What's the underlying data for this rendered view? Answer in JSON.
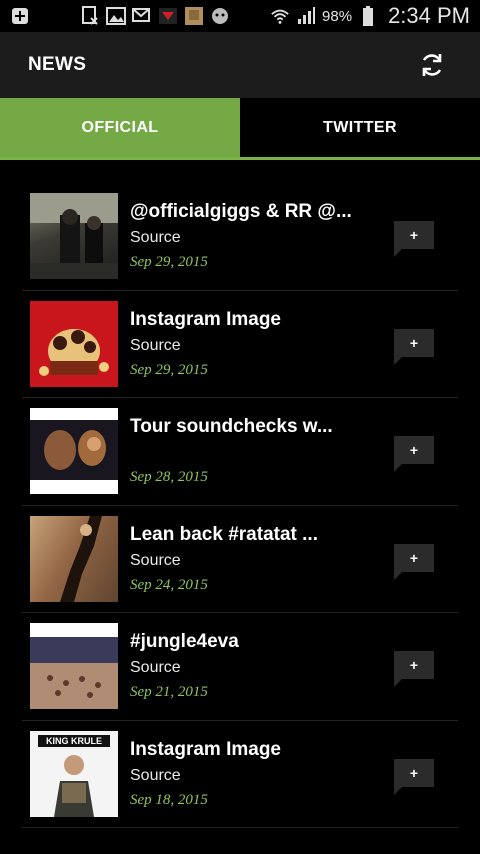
{
  "status_bar": {
    "battery": "98%",
    "time": "2:34 PM"
  },
  "app_bar": {
    "title": "NEWS",
    "refresh_icon": "refresh-icon"
  },
  "tabs": [
    {
      "label": "OFFICIAL",
      "active": true
    },
    {
      "label": "TWITTER",
      "active": false
    }
  ],
  "colors": {
    "accent": "#74a945",
    "date": "#8fc45e",
    "background": "#000000",
    "app_bar": "#1c1c1c"
  },
  "news": [
    {
      "title": "@officialgiggs & RR @...",
      "source": "Source",
      "date": "Sep 29, 2015",
      "add_label": "+",
      "thumb_text": ""
    },
    {
      "title": "Instagram Image",
      "source": "Source",
      "date": "Sep 29, 2015",
      "add_label": "+",
      "thumb_text": ""
    },
    {
      "title": "Tour soundchecks w...",
      "source": "",
      "date": "Sep 28, 2015",
      "add_label": "+",
      "thumb_text": ""
    },
    {
      "title": "Lean back #ratatat  ...",
      "source": "Source",
      "date": "Sep 24, 2015",
      "add_label": "+",
      "thumb_text": ""
    },
    {
      "title": "#jungle4eva",
      "source": "Source",
      "date": "Sep 21, 2015",
      "add_label": "+",
      "thumb_text": ""
    },
    {
      "title": "Instagram Image",
      "source": "Source",
      "date": "Sep 18, 2015",
      "add_label": "+",
      "thumb_text": "KING KRULE"
    }
  ]
}
